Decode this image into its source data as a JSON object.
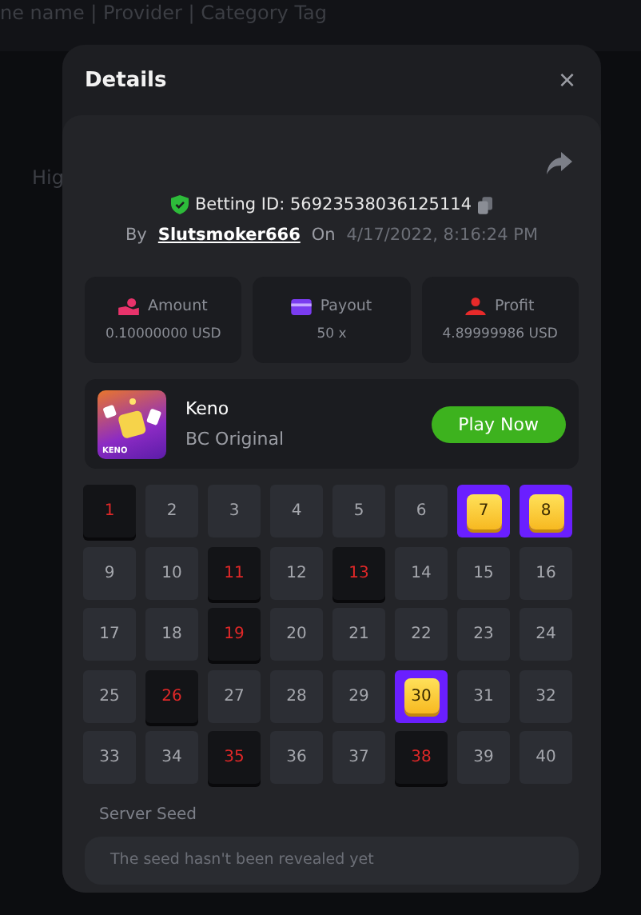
{
  "background": {
    "search_hint": "ne name | Provider | Category Tag",
    "tab_label": "Hig"
  },
  "dialog": {
    "title": "Details",
    "close": "×"
  },
  "bet": {
    "id_label": "Betting ID: 56923538036125114",
    "verified": true,
    "by_label": "By",
    "user": "Slutsmoker666",
    "on_label": "On",
    "date": "4/17/2022, 8:16:24 PM"
  },
  "stats": [
    {
      "kind": "amount",
      "label": "Amount",
      "value": "0.10000000 USD"
    },
    {
      "kind": "payout",
      "label": "Payout",
      "value": "50 x"
    },
    {
      "kind": "profit",
      "label": "Profit",
      "value": "4.89999986 USD"
    }
  ],
  "game": {
    "name": "Keno",
    "provider": "BC Original",
    "thumb_label": "KENO",
    "button": "Play Now"
  },
  "grid": [
    {
      "n": "1",
      "kind": "drawn"
    },
    {
      "n": "2",
      "kind": "plain"
    },
    {
      "n": "3",
      "kind": "plain"
    },
    {
      "n": "4",
      "kind": "plain"
    },
    {
      "n": "5",
      "kind": "plain"
    },
    {
      "n": "6",
      "kind": "plain"
    },
    {
      "n": "7",
      "kind": "hit"
    },
    {
      "n": "8",
      "kind": "hit"
    },
    {
      "n": "9",
      "kind": "plain"
    },
    {
      "n": "10",
      "kind": "plain"
    },
    {
      "n": "11",
      "kind": "drawn"
    },
    {
      "n": "12",
      "kind": "plain"
    },
    {
      "n": "13",
      "kind": "drawn"
    },
    {
      "n": "14",
      "kind": "plain"
    },
    {
      "n": "15",
      "kind": "plain"
    },
    {
      "n": "16",
      "kind": "plain"
    },
    {
      "n": "17",
      "kind": "plain"
    },
    {
      "n": "18",
      "kind": "plain"
    },
    {
      "n": "19",
      "kind": "drawn"
    },
    {
      "n": "20",
      "kind": "plain"
    },
    {
      "n": "21",
      "kind": "plain"
    },
    {
      "n": "22",
      "kind": "plain"
    },
    {
      "n": "23",
      "kind": "plain"
    },
    {
      "n": "24",
      "kind": "plain"
    },
    {
      "n": "25",
      "kind": "plain"
    },
    {
      "n": "26",
      "kind": "drawn"
    },
    {
      "n": "27",
      "kind": "plain"
    },
    {
      "n": "28",
      "kind": "plain"
    },
    {
      "n": "29",
      "kind": "plain"
    },
    {
      "n": "30",
      "kind": "hit"
    },
    {
      "n": "31",
      "kind": "plain"
    },
    {
      "n": "32",
      "kind": "plain"
    },
    {
      "n": "33",
      "kind": "plain"
    },
    {
      "n": "34",
      "kind": "plain"
    },
    {
      "n": "35",
      "kind": "drawn"
    },
    {
      "n": "36",
      "kind": "plain"
    },
    {
      "n": "37",
      "kind": "plain"
    },
    {
      "n": "38",
      "kind": "drawn"
    },
    {
      "n": "39",
      "kind": "plain"
    },
    {
      "n": "40",
      "kind": "plain"
    }
  ],
  "seed": {
    "label": "Server Seed",
    "text": "The seed hasn't been revealed yet"
  }
}
